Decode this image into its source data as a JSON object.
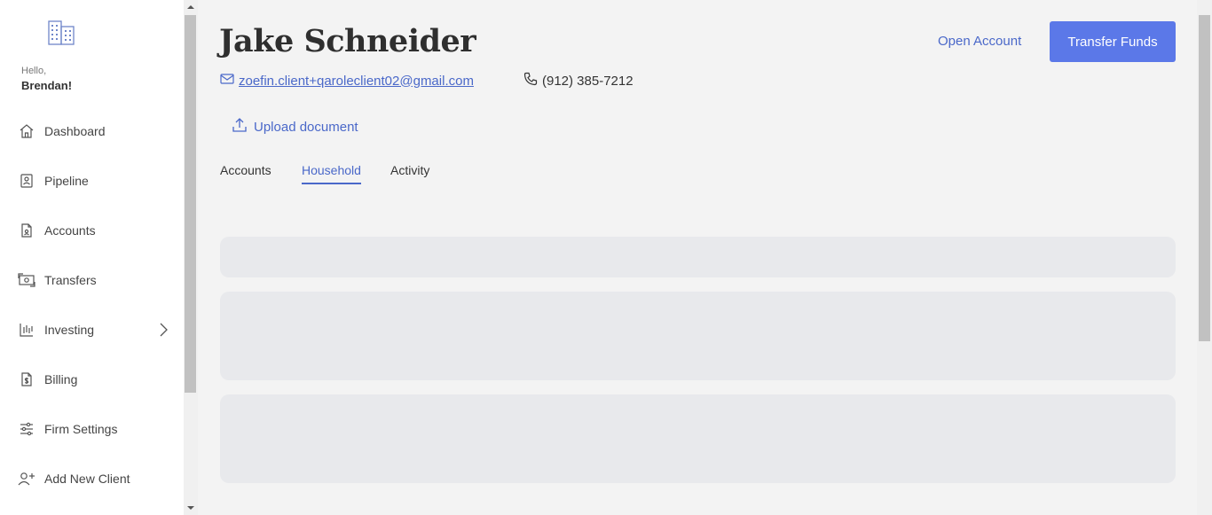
{
  "sidebar": {
    "greeting": "Hello,",
    "user_name": "Brendan!",
    "items": [
      {
        "label": "Dashboard",
        "icon": "home-icon"
      },
      {
        "label": "Pipeline",
        "icon": "pipeline-icon"
      },
      {
        "label": "Accounts",
        "icon": "accounts-icon"
      },
      {
        "label": "Transfers",
        "icon": "transfers-icon"
      },
      {
        "label": "Investing",
        "icon": "investing-icon"
      },
      {
        "label": "Billing",
        "icon": "billing-icon"
      },
      {
        "label": "Firm Settings",
        "icon": "sliders-icon"
      },
      {
        "label": "Add New Client",
        "icon": "add-user-icon"
      }
    ]
  },
  "client": {
    "name": "Jake Schneider",
    "email": "zoefin.client+qaroleclient02@gmail.com",
    "phone": "(912) 385-7212"
  },
  "actions": {
    "upload_label": "Upload document",
    "open_account_label": "Open Account",
    "transfer_label": "Transfer Funds"
  },
  "tabs": [
    {
      "label": "Accounts",
      "active": false
    },
    {
      "label": "Household",
      "active": true
    },
    {
      "label": "Activity",
      "active": false
    }
  ],
  "colors": {
    "accent": "#4a68c9",
    "button": "#5b78e8",
    "background": "#f3f3f3",
    "skeleton": "#e8e9ec"
  }
}
